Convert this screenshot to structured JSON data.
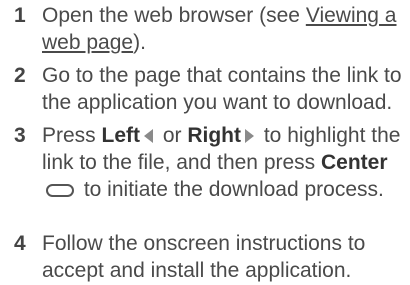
{
  "steps": [
    {
      "number": "1",
      "text_before": "Open the web browser (see ",
      "link_text": "Viewing a web page",
      "text_after": ")."
    },
    {
      "number": "2",
      "text": "Go to the page that contains the link to the application you want to download."
    },
    {
      "number": "3",
      "press": "Press ",
      "left_label": "Left",
      "left_icon": "left-arrow-icon",
      "or_text": " or ",
      "right_label": "Right",
      "right_icon": "right-arrow-icon",
      "mid_text": " to highlight the link to the file, and then press ",
      "center_label": "Center",
      "center_icon": "center-button-icon",
      "end_text": " to initiate the download process."
    },
    {
      "number": "4",
      "text": "Follow the onscreen instructions to accept and install the application."
    }
  ]
}
